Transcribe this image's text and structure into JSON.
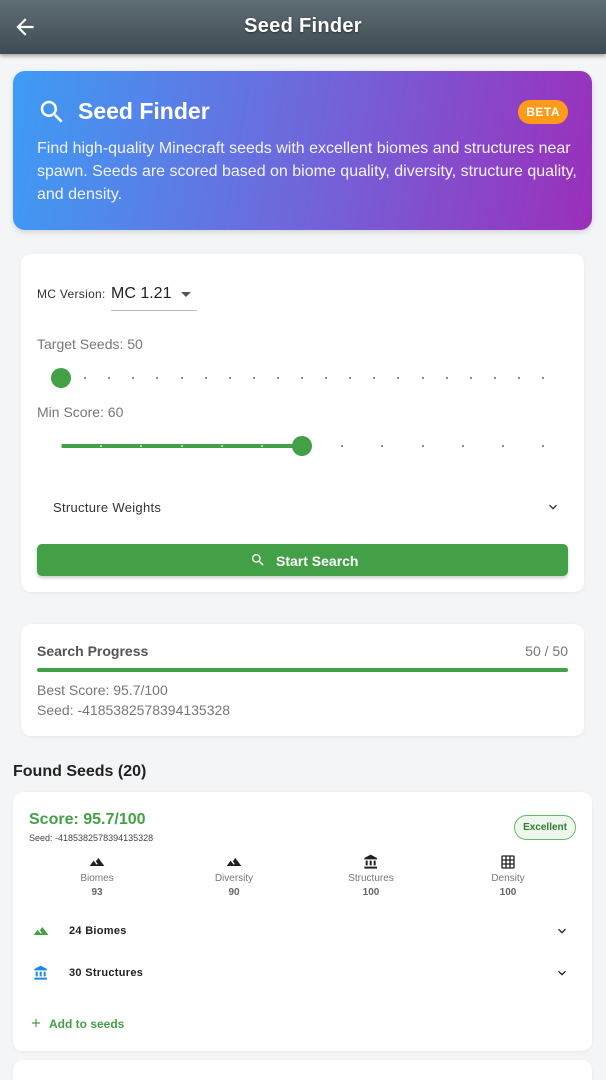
{
  "appbar": {
    "title": "Seed Finder"
  },
  "hero": {
    "title": "Seed Finder",
    "badge": "BETA",
    "description": "Find high-quality Minecraft seeds with excellent biomes and structures near spawn. Seeds are scored based on biome quality, diversity, structure quality, and density."
  },
  "settings": {
    "mc_version_label": "MC Version:",
    "mc_version_value": "MC 1.21",
    "target_seeds_label": "Target Seeds: 50",
    "target_seeds_fraction": 0.0,
    "min_score_label": "Min Score: 60",
    "min_score_fraction": 0.5,
    "structure_weights_label": "Structure Weights",
    "start_button": "Start Search"
  },
  "progress": {
    "title": "Search Progress",
    "count": "50 / 50",
    "fraction": 1.0,
    "best_score": "Best Score: 95.7/100",
    "seed": "Seed: -4185382578394135328"
  },
  "found": {
    "title": "Found Seeds (20)",
    "items": [
      {
        "score": "Score: 95.7/100",
        "seed": "Seed: -4185382578394135328",
        "badge": "Excellent",
        "metrics": [
          {
            "label": "Biomes",
            "value": "93",
            "icon": "terrain-icon"
          },
          {
            "label": "Diversity",
            "value": "90",
            "icon": "terrain-icon"
          },
          {
            "label": "Structures",
            "value": "100",
            "icon": "bank-icon"
          },
          {
            "label": "Density",
            "value": "100",
            "icon": "grid-icon"
          }
        ],
        "biomes_row": "24 Biomes",
        "structures_row": "30 Structures",
        "add_link": "Add to seeds"
      }
    ]
  },
  "colors": {
    "accent": "#43a047",
    "beta": "#ff9a1a",
    "structure_blue": "#1e88e5"
  }
}
